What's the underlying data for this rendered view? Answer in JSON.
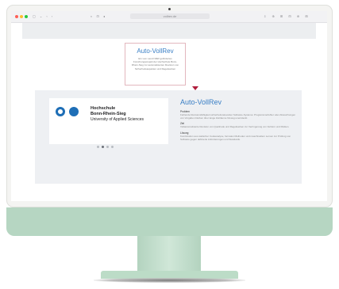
{
  "browser": {
    "address": "vollrev.de",
    "left_icons": "▢ ⌄ ‹ ›",
    "nav_icons": "◐ ⊡ ◂",
    "right_icons": "⇩ ⊕ ⊞ ⊟ ⊕ ⊞"
  },
  "callout": {
    "title": "Auto-VollRev",
    "text": "Ein vom Land NRW gefördertes Forschungsprojekt der Hochschule Bonn-Rhein-Sieg zur automatisierten Revision von Sicherheitsaspekten und Regelwerken"
  },
  "logo": {
    "line1": "Hochschule",
    "line2": "Bonn-Rhein-Sieg",
    "line3": "University of Applied Sciences",
    "brand_color": "#1e6eb6"
  },
  "info": {
    "title": "Auto-VollRev",
    "sections": [
      {
        "heading": "Problem",
        "text": "Fehlende Revisionsfähigkeit sicherheitsrelevanter Software-Systeme: Programmierfehler oder Abweichungen von Vorgaben bleiben über lange Zeiträume hinweg unentdeckt."
      },
      {
        "heading": "Ziel",
        "text": "Vollautomatisierte Revision von Quellcode und Regelwerken zur Verringerung von Fehlern und Risiken."
      },
      {
        "heading": "Lösung",
        "text": "Kombination aus statischer Codeanalyse, formalen Methoden und maschinellem Lernen zur Prüfung von Software gegen definierte Anforderungen und Standards."
      }
    ]
  },
  "carousel": {
    "count": 4,
    "active_index": 1
  },
  "colors": {
    "accent_blue": "#3a7fc5",
    "marker_red": "#b01e3d",
    "imac_green": "#b6d6c2"
  }
}
